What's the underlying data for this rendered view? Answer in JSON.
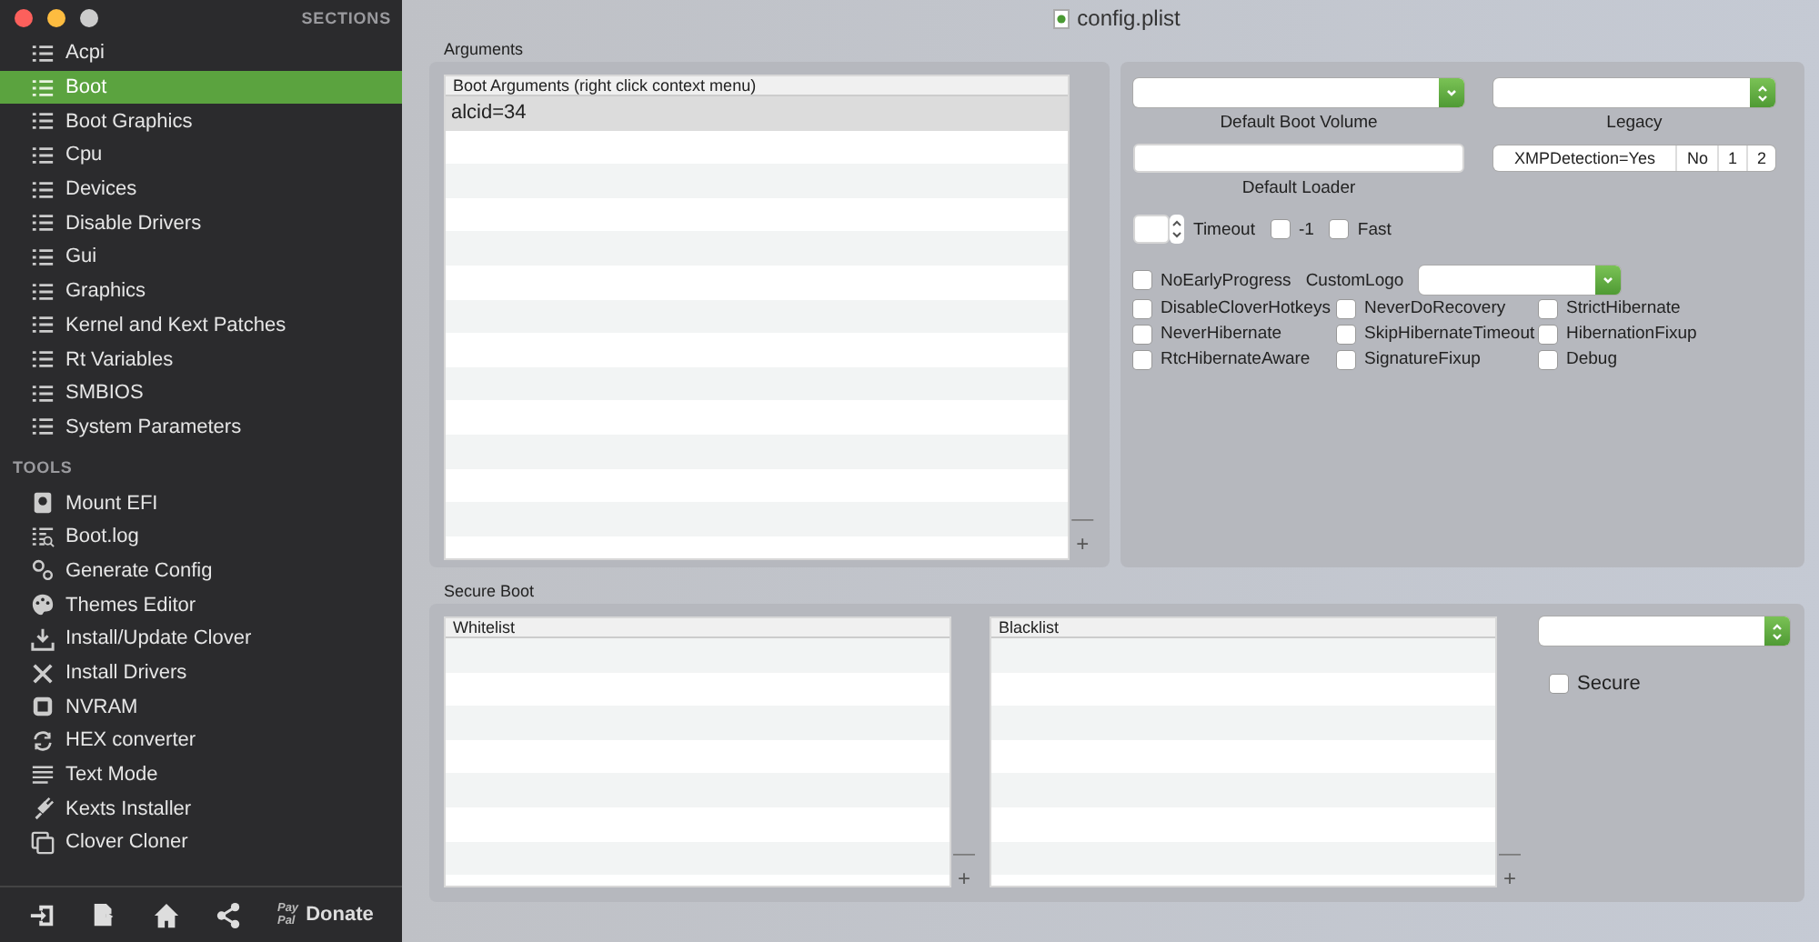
{
  "window": {
    "title": "config.plist"
  },
  "sidebar": {
    "sections_header": "SECTIONS",
    "sections": [
      {
        "label": "Acpi",
        "selected": false
      },
      {
        "label": "Boot",
        "selected": true
      },
      {
        "label": "Boot Graphics",
        "selected": false
      },
      {
        "label": "Cpu",
        "selected": false
      },
      {
        "label": "Devices",
        "selected": false
      },
      {
        "label": "Disable Drivers",
        "selected": false
      },
      {
        "label": "Gui",
        "selected": false
      },
      {
        "label": "Graphics",
        "selected": false
      },
      {
        "label": "Kernel and Kext Patches",
        "selected": false
      },
      {
        "label": "Rt Variables",
        "selected": false
      },
      {
        "label": "SMBIOS",
        "selected": false
      },
      {
        "label": "System Parameters",
        "selected": false
      }
    ],
    "tools_header": "TOOLS",
    "tools": [
      {
        "label": "Mount EFI",
        "kind": "disk"
      },
      {
        "label": "Boot.log",
        "kind": "log"
      },
      {
        "label": "Generate Config",
        "kind": "gears"
      },
      {
        "label": "Themes Editor",
        "kind": "palette"
      },
      {
        "label": "Install/Update Clover",
        "kind": "download"
      },
      {
        "label": "Install Drivers",
        "kind": "tools"
      },
      {
        "label": "NVRAM",
        "kind": "chip"
      },
      {
        "label": "HEX converter",
        "kind": "refresh"
      },
      {
        "label": "Text Mode",
        "kind": "lines"
      },
      {
        "label": "Kexts Installer",
        "kind": "plug"
      },
      {
        "label": "Clover Cloner",
        "kind": "copy"
      }
    ],
    "donate": {
      "paypal": [
        "Pay",
        "Pal"
      ],
      "label": "Donate"
    }
  },
  "arguments": {
    "title": "Arguments",
    "column": "Boot Arguments (right click context menu)",
    "rows": [
      {
        "text": "alcid=34",
        "selected": true
      }
    ],
    "remove": "—",
    "add": "+"
  },
  "boot_options": {
    "default_boot_volume": "Default Boot Volume",
    "legacy": "Legacy",
    "default_loader": "Default Loader",
    "xmp_detection": [
      {
        "label": "XMPDetection=Yes",
        "selected": false
      },
      {
        "label": "No",
        "selected": false
      },
      {
        "label": "1",
        "selected": false
      },
      {
        "label": "2",
        "selected": false
      }
    ],
    "timeout": "Timeout",
    "timeout_flags": [
      {
        "label": "-1",
        "checked": false
      },
      {
        "label": "Fast",
        "checked": false
      }
    ],
    "no_early_progress": {
      "label": "NoEarlyProgress",
      "checked": false
    },
    "custom_logo": "CustomLogo",
    "flags": [
      {
        "label": "DisableCloverHotkeys",
        "checked": false
      },
      {
        "label": "NeverDoRecovery",
        "checked": false
      },
      {
        "label": "StrictHibernate",
        "checked": false
      },
      {
        "label": "NeverHibernate",
        "checked": false
      },
      {
        "label": "SkipHibernateTimeout",
        "checked": false
      },
      {
        "label": "HibernationFixup",
        "checked": false
      },
      {
        "label": "RtcHibernateAware",
        "checked": false
      },
      {
        "label": "SignatureFixup",
        "checked": false
      },
      {
        "label": "Debug",
        "checked": false
      }
    ]
  },
  "secure_boot": {
    "title": "Secure Boot",
    "lists": [
      {
        "column": "Whitelist",
        "remove": "—",
        "add": "+"
      },
      {
        "column": "Blacklist",
        "remove": "—",
        "add": "+"
      }
    ],
    "secure": {
      "label": "Secure",
      "checked": false
    }
  }
}
